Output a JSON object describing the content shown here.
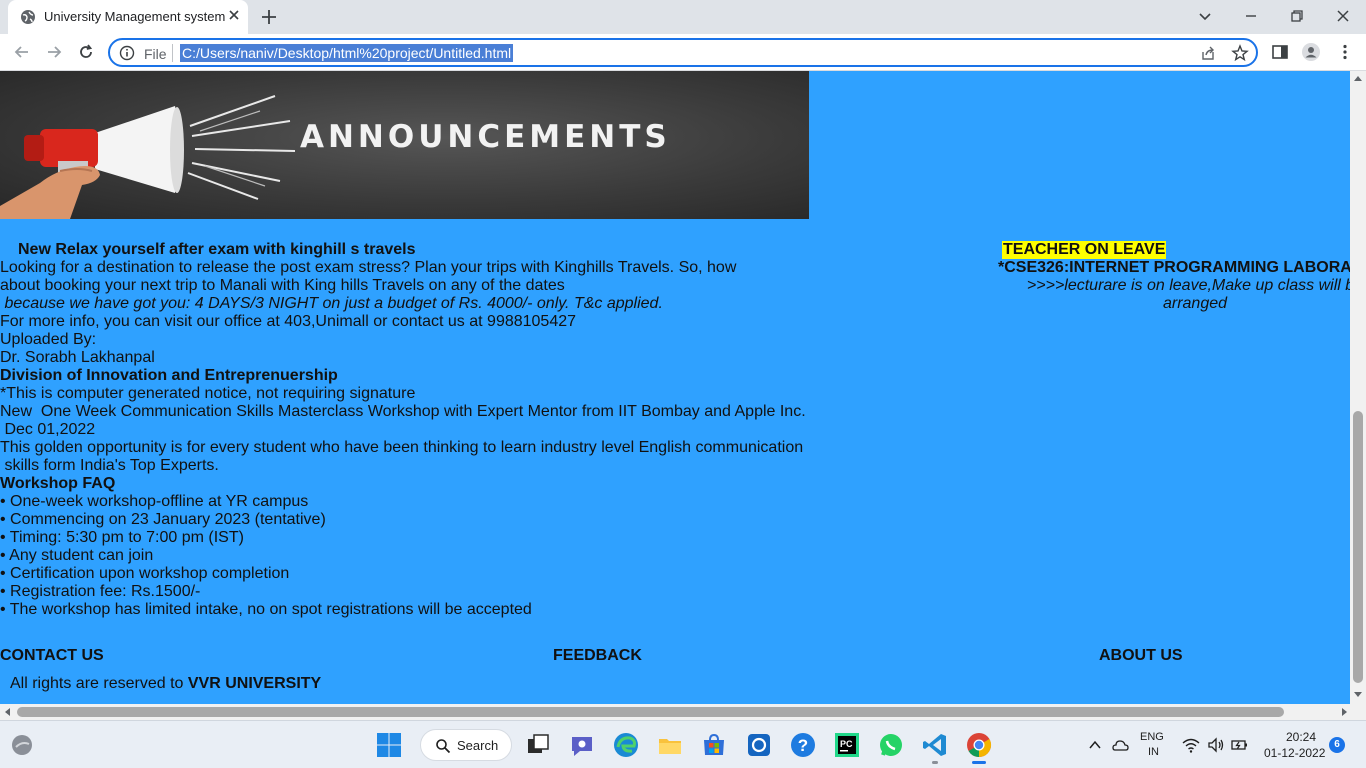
{
  "browser": {
    "tab_title": "University Management system",
    "omnibox_scheme": "File",
    "url": "C:/Users/naniv/Desktop/html%20project/Untitled.html"
  },
  "page": {
    "banner_text": "ANNOUNCEMENTS",
    "lines": [
      "New Relax yourself after exam with kinghill s travels",
      "Looking for a destination to release the post exam stress? Plan your trips with Kinghills Travels. So, how",
      "about booking your next trip to Manali with King hills Travels on any of the dates",
      " because we have got you: 4 DAYS/3 NIGHT on just a budget of Rs. 4000/- only. T&c applied.",
      "For more info, you can visit our office at 403,Unimall or contact us at 9988105427",
      "Uploaded By:",
      "Dr. Sorabh Lakhanpal",
      "Division of Innovation and Entreprenuership",
      "*This is computer generated notice, not requiring signature",
      "New  One Week Communication Skills Masterclass Workshop with Expert Mentor from IIT Bombay and Apple Inc.",
      " Dec 01,2022",
      "This golden opportunity is for every student who have been thinking to learn industry level English communication",
      " skills form India's Top Experts.",
      "Workshop FAQ",
      "• One-week workshop-offline at YR campus",
      "• Commencing on 23 January 2023 (tentative)",
      "• Timing: 5:30 pm to 7:00 pm (IST)",
      "• Any student can join",
      "• Certification upon workshop completion",
      "• Registration fee: Rs.1500/-",
      "• The workshop has limited intake, no on spot registrations will be accepted"
    ],
    "leave": {
      "title": "TEACHER ON LEAVE",
      "course": "*CSE326:INTERNET PROGRAMMING LABORA",
      "message": ">>>>lecturare is on leave,Make up class will be arranged"
    },
    "footer": {
      "contact": "CONTACT US",
      "feedback": "FEEDBACK",
      "about": "ABOUT US",
      "rights_prefix": "All rights are reserved to ",
      "rights_org": "VVR UNIVERSITY"
    }
  },
  "taskbar": {
    "search_label": "Search",
    "lang_line1": "ENG",
    "lang_line2": "IN",
    "time": "20:24",
    "date": "01-12-2022",
    "notification_count": "6"
  }
}
